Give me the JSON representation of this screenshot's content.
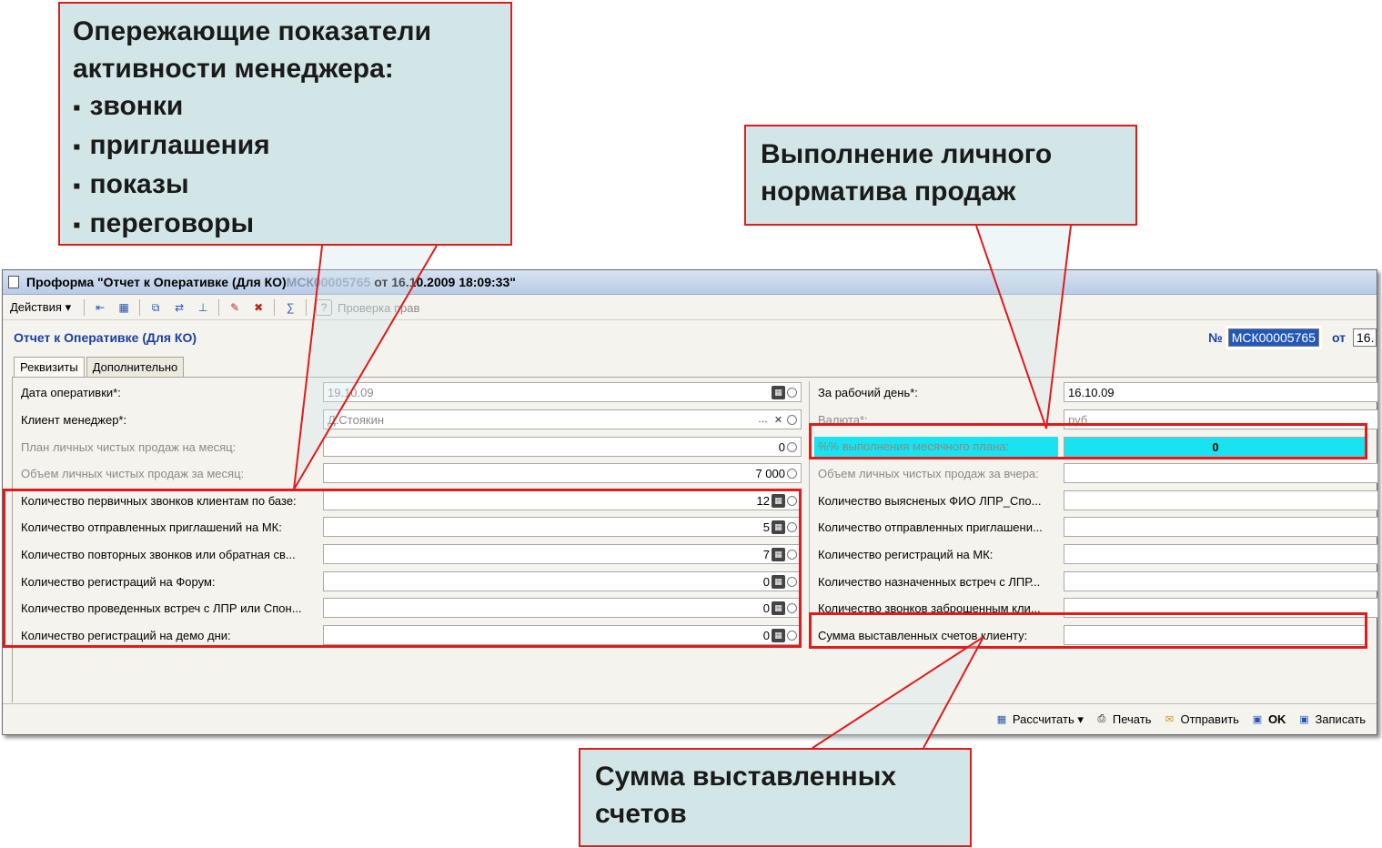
{
  "callouts": {
    "top_left": {
      "title": "Опережающие показатели активности менеджера:",
      "items": [
        "звонки",
        "приглашения",
        "показы",
        "переговоры"
      ]
    },
    "top_right": {
      "text": "Выполнение личного норматива продаж"
    },
    "bottom": {
      "text": "Сумма выставленных счетов"
    }
  },
  "window": {
    "title_prefix": "Проформа \"Отчет к Оперативке (Для КО)",
    "title_num": "МСК00005765",
    "title_suffix": "от 16.10.2009 18:09:33\"",
    "toolbar": {
      "actions_label": "Действия ▾",
      "help_label": "?",
      "check_rights_label": "Проверка прав"
    },
    "form_title": "Отчет к Оперативке (Для КО)",
    "num_label": "№",
    "num_value": "МСК00005765",
    "from_label": "от",
    "date_value": "16.",
    "tabs": [
      "Реквизиты",
      "Дополнительно"
    ],
    "left_fields": [
      {
        "label": "Дата оперативки*:",
        "value": "19.10.09",
        "dim_label": false
      },
      {
        "label": "Клиент менеджер*:",
        "value": "Д.Стоякин",
        "dim_label": false
      },
      {
        "label": "План личных чистых продаж на месяц:",
        "value": "0",
        "dim_label": true
      },
      {
        "label": "Объем личных чистых продаж за месяц:",
        "value": "7 000",
        "dim_label": true
      },
      {
        "label": "Количество первичных звонков клиентам по базе:",
        "value": "12",
        "dim_label": false
      },
      {
        "label": "Количество отправленных приглашений на МК:",
        "value": "5",
        "dim_label": false
      },
      {
        "label": "Количество повторных звонков или обратная св...",
        "value": "7",
        "dim_label": false
      },
      {
        "label": "Количество регистраций на Форум:",
        "value": "0",
        "dim_label": false
      },
      {
        "label": "Количество проведенных встреч с ЛПР или Спон...",
        "value": "0",
        "dim_label": false
      },
      {
        "label": "Количество регистраций на демо дни:",
        "value": "0",
        "dim_label": false
      }
    ],
    "right_fields": [
      {
        "label": "За рабочий день*:",
        "value": "16.10.09",
        "dim_label": false
      },
      {
        "label": "Валюта*:",
        "value": "руб",
        "dim_label": true
      },
      {
        "label": "%% выполнения месячного плана:",
        "value": "0",
        "dim_label": true
      },
      {
        "label": "Объем личных чистых продаж за вчера:",
        "value": "",
        "dim_label": true
      },
      {
        "label": "Количество выясненых ФИО ЛПР_Спо...",
        "value": "",
        "dim_label": false
      },
      {
        "label": "Количество отправленных приглашени...",
        "value": "",
        "dim_label": false
      },
      {
        "label": "Количество регистраций на МК:",
        "value": "",
        "dim_label": false
      },
      {
        "label": "Количество назначенных встреч с ЛПР...",
        "value": "",
        "dim_label": false
      },
      {
        "label": "Количество звонков заброшенным кли...",
        "value": "",
        "dim_label": false
      },
      {
        "label": "Сумма выставленных счетов клиенту:",
        "value": "",
        "dim_label": false
      }
    ],
    "bottom_bar": {
      "calc": "Рассчитать ▾",
      "print": "Печать",
      "send": "Отправить",
      "ok": "OK",
      "save": "Записать"
    }
  },
  "colors": {
    "accent_red": "#e01b1b",
    "callout_bg": "#d2e6e8",
    "highlight_cyan": "#19e3ee",
    "form_title_blue": "#1b3fa6"
  }
}
